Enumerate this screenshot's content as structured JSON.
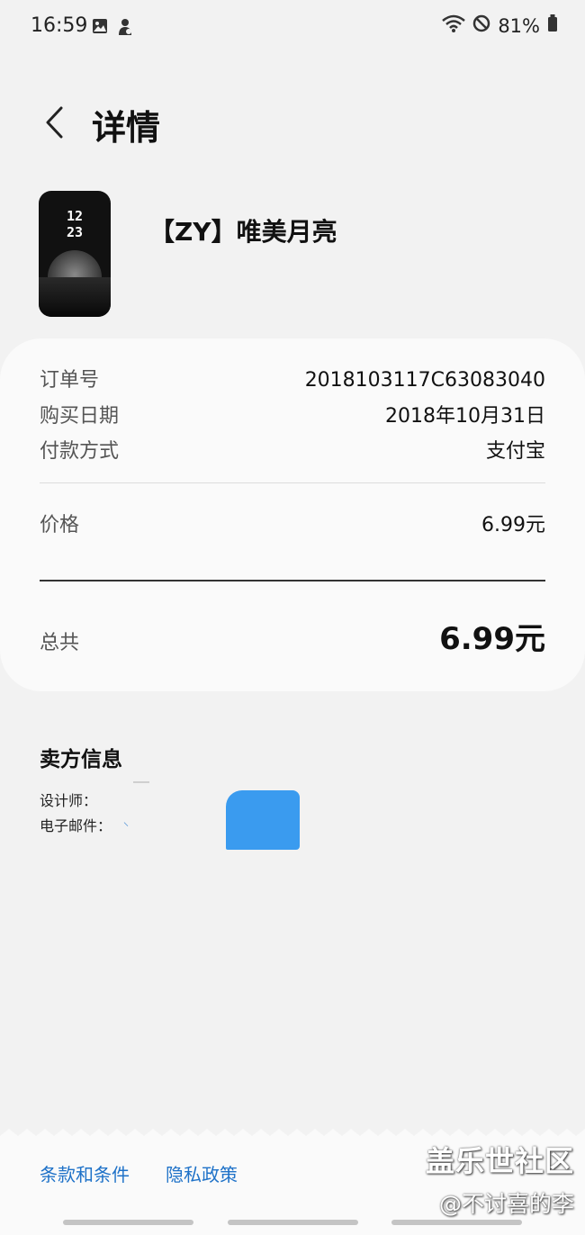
{
  "status_bar": {
    "time": "16:59",
    "battery": "81%",
    "icons": [
      "gallery-icon",
      "person-notification-icon",
      "wifi-icon",
      "do-not-disturb-icon",
      "battery-icon"
    ]
  },
  "header": {
    "back_icon": "chevron-left-icon",
    "title": "详情"
  },
  "product": {
    "name": "【ZY】唯美月亮",
    "thumbnail": {
      "hour": "12",
      "minute": "23"
    }
  },
  "order": {
    "order_number_label": "订单号",
    "order_number_value": "2018103117C63083040",
    "purchase_date_label": "购买日期",
    "purchase_date_value": "2018年10月31日",
    "payment_method_label": "付款方式",
    "payment_method_value": "支付宝",
    "price_label": "价格",
    "price_value": "6.99元",
    "total_label": "总共",
    "total_value": "6.99元"
  },
  "seller": {
    "title": "卖方信息",
    "designer_label": "设计师：",
    "email_label": "电子邮件："
  },
  "footer": {
    "terms_link": "条款和条件",
    "privacy_link": "隐私政策"
  },
  "watermark": {
    "main": "盖乐世社区",
    "sub": "@不讨喜的李"
  },
  "colors": {
    "background": "#f2f2f2",
    "card": "#fafafa",
    "link": "#1f72c8",
    "redaction": "#3a9bef"
  }
}
